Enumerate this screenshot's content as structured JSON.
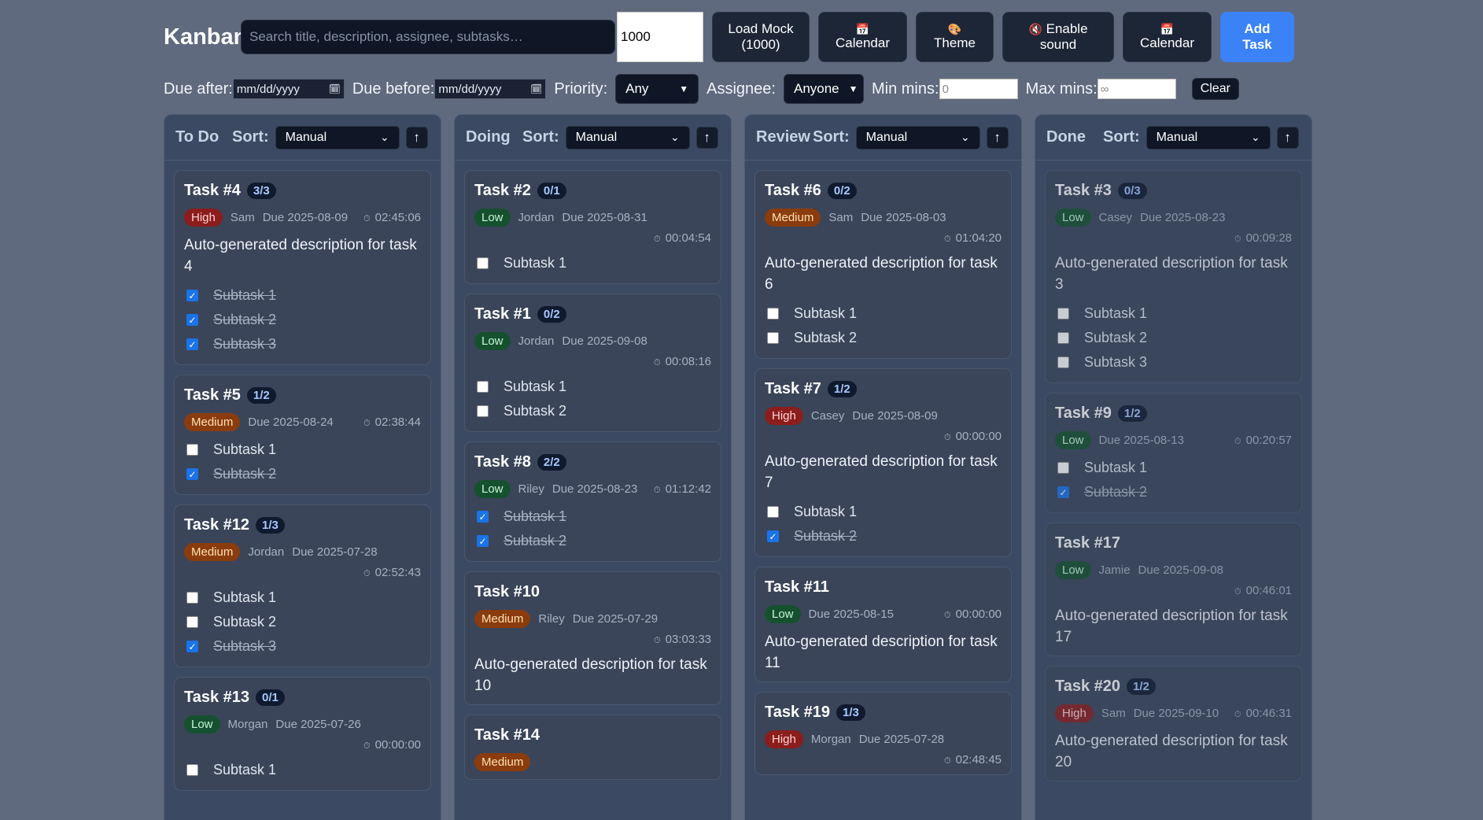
{
  "header": {
    "title": "Kanban",
    "search_placeholder": "Search title, description, assignee, subtasks…",
    "mock_count": "1000",
    "buttons": {
      "load_mock": [
        "Load Mock",
        "(1000)"
      ],
      "calendar1": "Calendar",
      "theme": "Theme",
      "sound": [
        "Enable",
        "sound"
      ],
      "calendar2": "Calendar",
      "add_task": [
        "Add",
        "Task"
      ]
    }
  },
  "filters": {
    "due_after_label": "Due after:",
    "due_before_label": "Due before:",
    "date_placeholder": "mm/dd/yyyy",
    "priority_label": "Priority:",
    "priority_value": "Any",
    "assignee_label": "Assignee:",
    "assignee_value": "Anyone",
    "min_label": "Min mins:",
    "min_placeholder": "0",
    "max_label": "Max mins:",
    "max_placeholder": "∞",
    "clear_label": "Clear"
  },
  "sort_label": "Sort:",
  "sort_value": "Manual",
  "sort_arrow": "↑",
  "columns": [
    {
      "name": "To Do",
      "done": false,
      "cards": [
        {
          "title": "Task #4",
          "progress": "3/3",
          "priority": "High",
          "assignee": "Sam",
          "due": "Due 2025-08-09",
          "timer": "02:45:06",
          "timer_inline": true,
          "description": "Auto-generated description for task 4",
          "subtasks": [
            {
              "label": "Subtask 1",
              "done": true
            },
            {
              "label": "Subtask 2",
              "done": true
            },
            {
              "label": "Subtask 3",
              "done": true
            }
          ]
        },
        {
          "title": "Task #5",
          "progress": "1/2",
          "priority": "Medium",
          "assignee": "",
          "due": "Due 2025-08-24",
          "timer": "02:38:44",
          "timer_inline": true,
          "description": "",
          "subtasks": [
            {
              "label": "Subtask 1",
              "done": false
            },
            {
              "label": "Subtask 2",
              "done": true
            }
          ]
        },
        {
          "title": "Task #12",
          "progress": "1/3",
          "priority": "Medium",
          "assignee": "Jordan",
          "due": "Due 2025-07-28",
          "timer": "02:52:43",
          "timer_inline": false,
          "description": "",
          "subtasks": [
            {
              "label": "Subtask 1",
              "done": false
            },
            {
              "label": "Subtask 2",
              "done": false
            },
            {
              "label": "Subtask 3",
              "done": true
            }
          ]
        },
        {
          "title": "Task #13",
          "progress": "0/1",
          "priority": "Low",
          "assignee": "Morgan",
          "due": "Due 2025-07-26",
          "timer": "00:00:00",
          "timer_inline": false,
          "description": "",
          "subtasks": [
            {
              "label": "Subtask 1",
              "done": false
            }
          ]
        }
      ]
    },
    {
      "name": "Doing",
      "done": false,
      "cards": [
        {
          "title": "Task #2",
          "progress": "0/1",
          "priority": "Low",
          "assignee": "Jordan",
          "due": "Due 2025-08-31",
          "timer": "00:04:54",
          "timer_inline": false,
          "description": "",
          "subtasks": [
            {
              "label": "Subtask 1",
              "done": false
            }
          ]
        },
        {
          "title": "Task #1",
          "progress": "0/2",
          "priority": "Low",
          "assignee": "Jordan",
          "due": "Due 2025-09-08",
          "timer": "00:08:16",
          "timer_inline": false,
          "description": "",
          "subtasks": [
            {
              "label": "Subtask 1",
              "done": false
            },
            {
              "label": "Subtask 2",
              "done": false
            }
          ]
        },
        {
          "title": "Task #8",
          "progress": "2/2",
          "priority": "Low",
          "assignee": "Riley",
          "due": "Due 2025-08-23",
          "timer": "01:12:42",
          "timer_inline": true,
          "description": "",
          "subtasks": [
            {
              "label": "Subtask 1",
              "done": true
            },
            {
              "label": "Subtask 2",
              "done": true
            }
          ]
        },
        {
          "title": "Task #10",
          "progress": "",
          "priority": "Medium",
          "assignee": "Riley",
          "due": "Due 2025-07-29",
          "timer": "03:03:33",
          "timer_inline": false,
          "description": "Auto-generated description for task 10",
          "subtasks": []
        },
        {
          "title": "Task #14",
          "progress": "",
          "priority": "Medium",
          "assignee": "",
          "due": "",
          "timer": "",
          "timer_inline": true,
          "description": "",
          "subtasks": []
        }
      ]
    },
    {
      "name": "Review",
      "done": false,
      "cards": [
        {
          "title": "Task #6",
          "progress": "0/2",
          "priority": "Medium",
          "assignee": "Sam",
          "due": "Due 2025-08-03",
          "timer": "01:04:20",
          "timer_inline": false,
          "description": "Auto-generated description for task 6",
          "subtasks": [
            {
              "label": "Subtask 1",
              "done": false
            },
            {
              "label": "Subtask 2",
              "done": false
            }
          ]
        },
        {
          "title": "Task #7",
          "progress": "1/2",
          "priority": "High",
          "assignee": "Casey",
          "due": "Due 2025-08-09",
          "timer": "00:00:00",
          "timer_inline": false,
          "description": "Auto-generated description for task 7",
          "subtasks": [
            {
              "label": "Subtask 1",
              "done": false
            },
            {
              "label": "Subtask 2",
              "done": true
            }
          ]
        },
        {
          "title": "Task #11",
          "progress": "",
          "priority": "Low",
          "assignee": "",
          "due": "Due 2025-08-15",
          "timer": "00:00:00",
          "timer_inline": true,
          "description": "Auto-generated description for task 11",
          "subtasks": []
        },
        {
          "title": "Task #19",
          "progress": "1/3",
          "priority": "High",
          "assignee": "Morgan",
          "due": "Due 2025-07-28",
          "timer": "02:48:45",
          "timer_inline": false,
          "description": "",
          "subtasks": []
        }
      ]
    },
    {
      "name": "Done",
      "done": true,
      "cards": [
        {
          "title": "Task #3",
          "progress": "0/3",
          "priority": "Low",
          "assignee": "Casey",
          "due": "Due 2025-08-23",
          "timer": "00:09:28",
          "timer_inline": false,
          "description": "Auto-generated description for task 3",
          "subtasks": [
            {
              "label": "Subtask 1",
              "done": false
            },
            {
              "label": "Subtask 2",
              "done": false
            },
            {
              "label": "Subtask 3",
              "done": false
            }
          ]
        },
        {
          "title": "Task #9",
          "progress": "1/2",
          "priority": "Low",
          "assignee": "",
          "due": "Due 2025-08-13",
          "timer": "00:20:57",
          "timer_inline": true,
          "description": "",
          "subtasks": [
            {
              "label": "Subtask 1",
              "done": false
            },
            {
              "label": "Subtask 2",
              "done": true
            }
          ]
        },
        {
          "title": "Task #17",
          "progress": "",
          "priority": "Low",
          "assignee": "Jamie",
          "due": "Due 2025-09-08",
          "timer": "00:46:01",
          "timer_inline": false,
          "description": "Auto-generated description for task 17",
          "subtasks": []
        },
        {
          "title": "Task #20",
          "progress": "1/2",
          "priority": "High",
          "assignee": "Sam",
          "due": "Due 2025-09-10",
          "timer": "00:46:31",
          "timer_inline": true,
          "description": "Auto-generated description for task 20",
          "subtasks": []
        }
      ]
    }
  ]
}
